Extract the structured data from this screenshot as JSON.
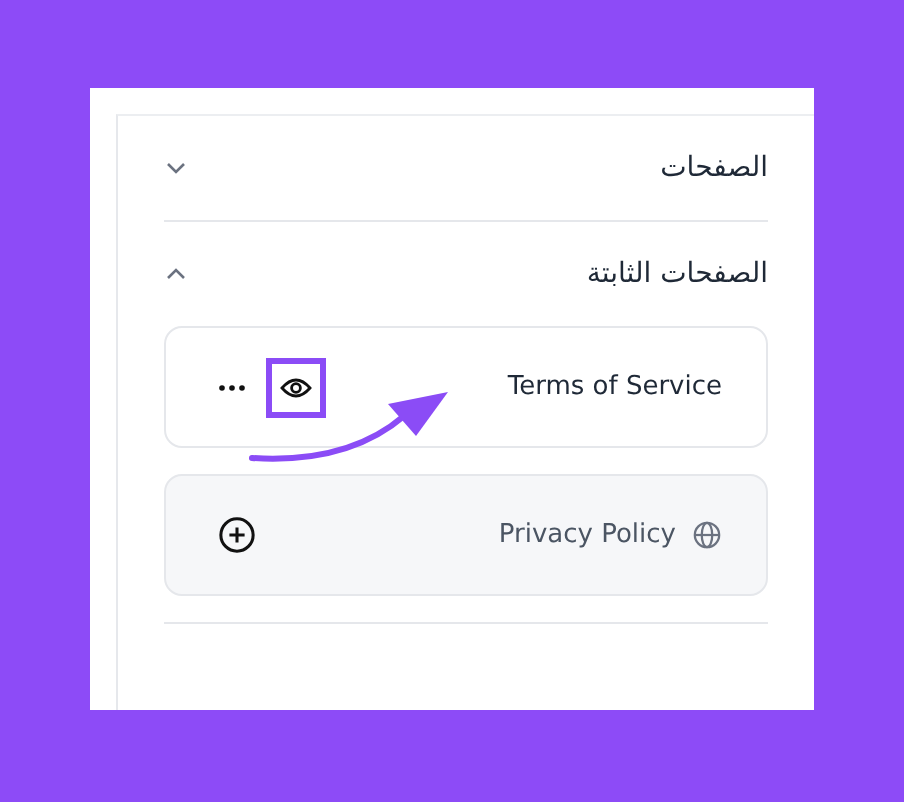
{
  "sections": [
    {
      "title": "الصفحات",
      "expanded": false
    },
    {
      "title": "الصفحات الثابتة",
      "expanded": true,
      "pages": [
        {
          "title": "Terms of Service",
          "kind": "editable",
          "highlighted": true
        },
        {
          "title": "Privacy Policy",
          "kind": "addable",
          "highlighted": false
        }
      ]
    }
  ]
}
